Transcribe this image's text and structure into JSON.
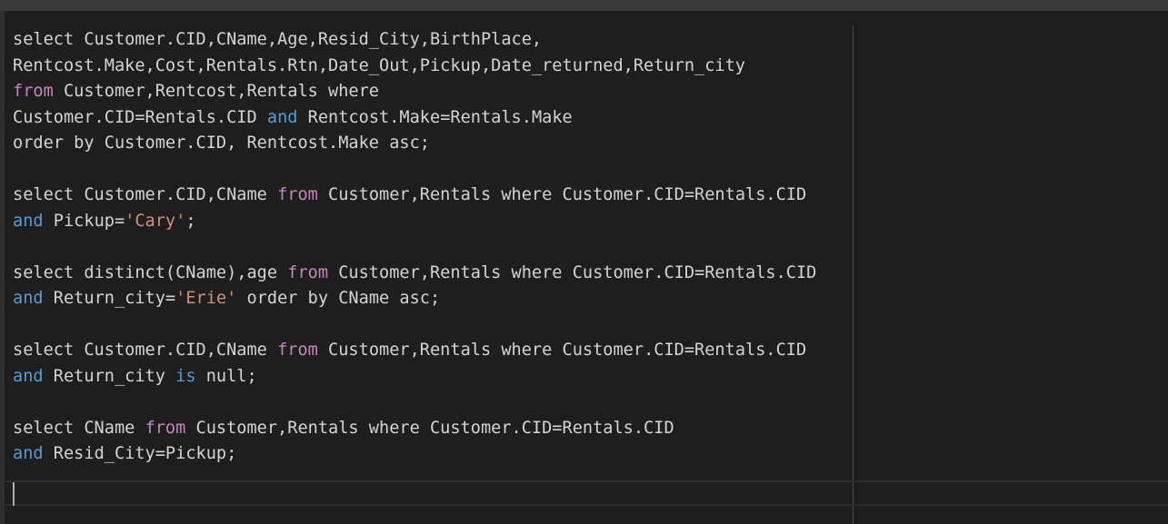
{
  "editor": {
    "language": "sql",
    "lines": [
      [
        {
          "t": "select Customer.CID,CName,Age,Resid_City,BirthPlace,",
          "c": "plain"
        }
      ],
      [
        {
          "t": "Rentcost.Make,Cost,Rentals.Rtn,Date_Out,Pickup,Date_returned,Return_city",
          "c": "plain"
        }
      ],
      [
        {
          "t": "from",
          "c": "kw"
        },
        {
          "t": " Customer,Rentcost,Rentals where",
          "c": "plain"
        }
      ],
      [
        {
          "t": "Customer.CID=Rentals.CID ",
          "c": "plain"
        },
        {
          "t": "and",
          "c": "op"
        },
        {
          "t": " Rentcost.Make=Rentals.Make",
          "c": "plain"
        }
      ],
      [
        {
          "t": "order by Customer.CID, Rentcost.Make asc;",
          "c": "plain"
        }
      ],
      [],
      [
        {
          "t": "select Customer.CID,CName ",
          "c": "plain"
        },
        {
          "t": "from",
          "c": "kw"
        },
        {
          "t": " Customer,Rentals where Customer.CID=Rentals.CID",
          "c": "plain"
        }
      ],
      [
        {
          "t": "and",
          "c": "op"
        },
        {
          "t": " Pickup=",
          "c": "plain"
        },
        {
          "t": "'Cary'",
          "c": "str"
        },
        {
          "t": ";",
          "c": "plain"
        }
      ],
      [],
      [
        {
          "t": "select distinct(CName),age ",
          "c": "plain"
        },
        {
          "t": "from",
          "c": "kw"
        },
        {
          "t": " Customer,Rentals where Customer.CID=Rentals.CID",
          "c": "plain"
        }
      ],
      [
        {
          "t": "and",
          "c": "op"
        },
        {
          "t": " Return_city=",
          "c": "plain"
        },
        {
          "t": "'Erie'",
          "c": "str"
        },
        {
          "t": " order by CName asc;",
          "c": "plain"
        }
      ],
      [],
      [
        {
          "t": "select Customer.CID,CName ",
          "c": "plain"
        },
        {
          "t": "from",
          "c": "kw"
        },
        {
          "t": " Customer,Rentals where Customer.CID=Rentals.CID",
          "c": "plain"
        }
      ],
      [
        {
          "t": "and",
          "c": "op"
        },
        {
          "t": " Return_city ",
          "c": "plain"
        },
        {
          "t": "is",
          "c": "op"
        },
        {
          "t": " null;",
          "c": "plain"
        }
      ],
      [],
      [
        {
          "t": "select CName ",
          "c": "plain"
        },
        {
          "t": "from",
          "c": "kw"
        },
        {
          "t": " Customer,Rentals where Customer.CID=Rentals.CID",
          "c": "plain"
        }
      ],
      [
        {
          "t": "and",
          "c": "op"
        },
        {
          "t": " Resid_City=Pickup;",
          "c": "plain"
        }
      ],
      [],
      []
    ]
  },
  "colors": {
    "background": "#1e1e1e",
    "text": "#d4d4d4",
    "keyword_from": "#c586c0",
    "keyword_and": "#569cd6",
    "string": "#ce9178"
  }
}
